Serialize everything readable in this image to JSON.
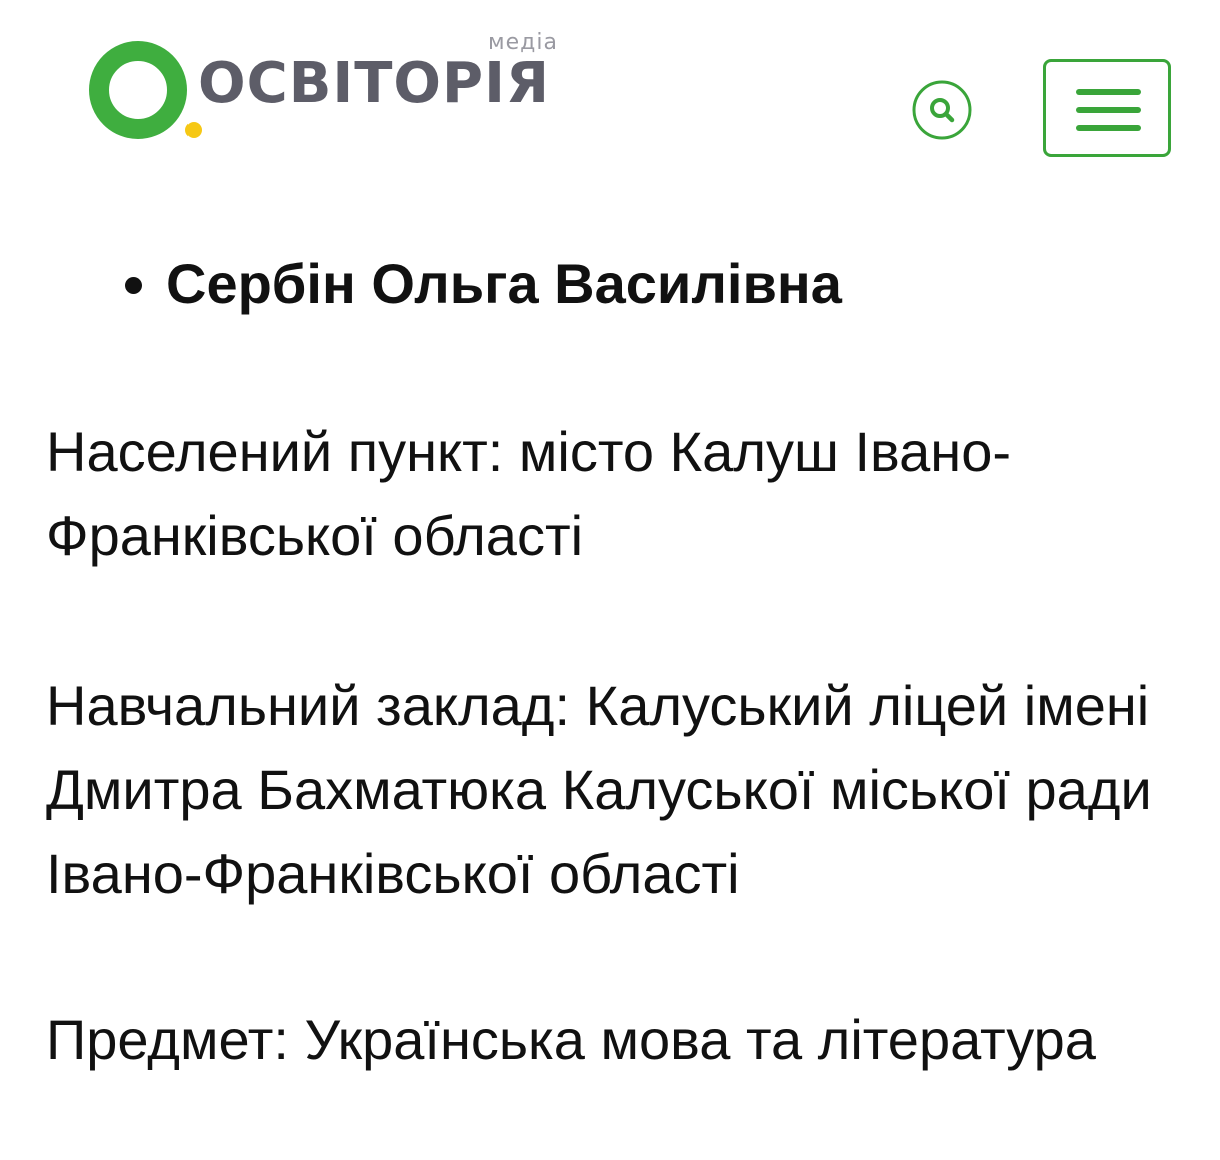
{
  "header": {
    "logo": {
      "sub_label": "медіа",
      "word": "ОСВІТОРІЯ",
      "colors": {
        "ring": "#3fae3f",
        "dot": "#f6c815",
        "word": "#5d5d68"
      }
    },
    "search": {
      "icon": "search-icon",
      "color": "#3aa53a"
    },
    "menu": {
      "icon": "hamburger-menu-icon",
      "color": "#3aa53a"
    }
  },
  "content": {
    "name": "Сербін Ольга Василівна",
    "location": "Населений пункт: місто Калуш Івано-Франківської області",
    "institution": "Навчальний заклад: Калуський ліцей імені Дмитра Бахматюка Калуської міської ради Івано-Франківської області",
    "subject": "Предмет: Українська мова та література"
  }
}
